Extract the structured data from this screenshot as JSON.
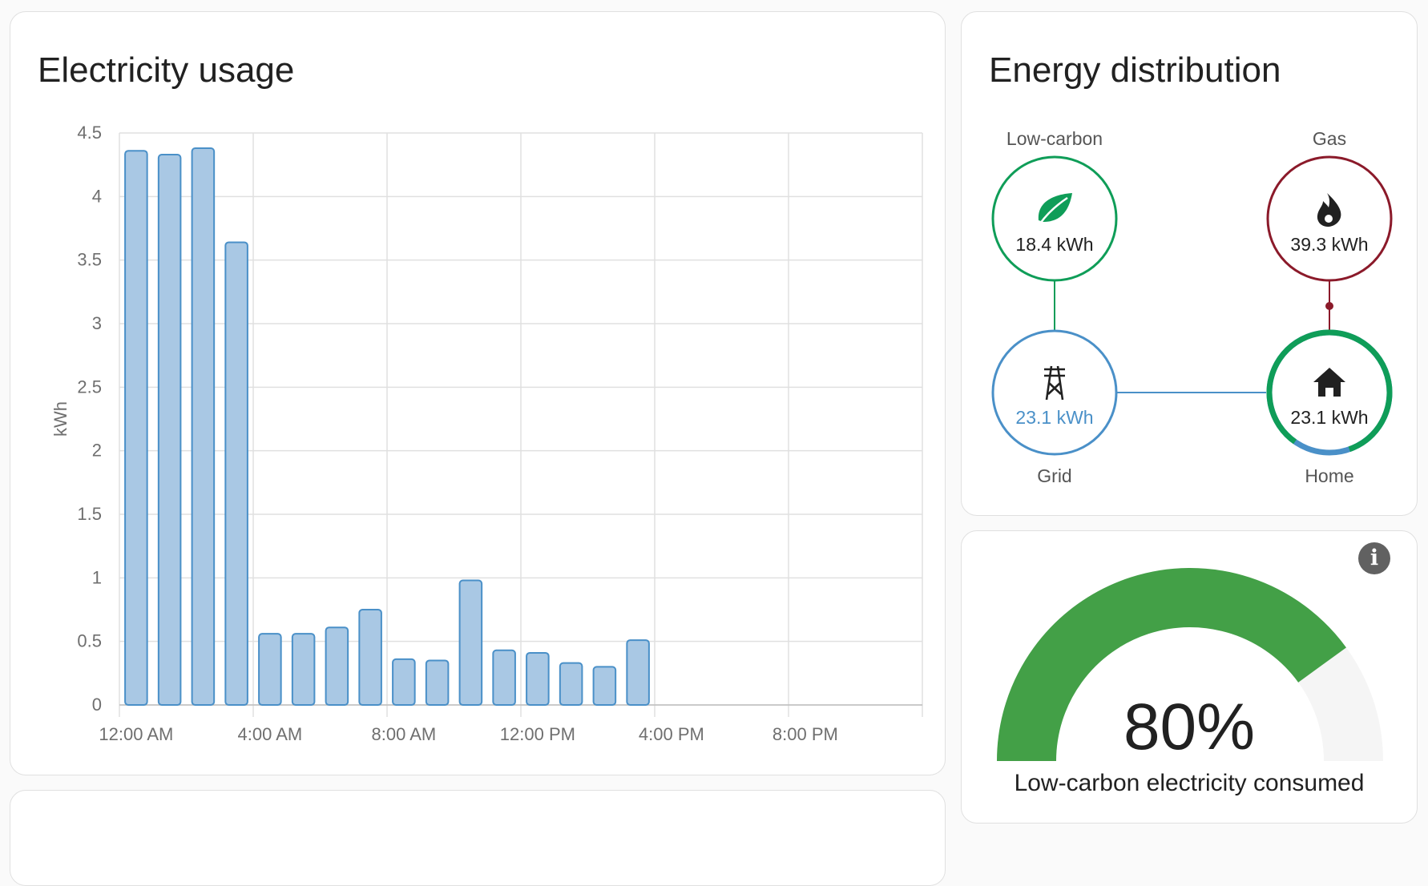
{
  "usage_card": {
    "title": "Electricity usage"
  },
  "chart_data": {
    "type": "bar",
    "title": "Electricity usage",
    "ylabel": "kWh",
    "xlabel": "",
    "ylim": [
      0,
      4.5
    ],
    "y_ticks": [
      "0",
      "0.5",
      "1",
      "1.5",
      "2",
      "2.5",
      "3",
      "3.5",
      "4",
      "4.5"
    ],
    "x_tick_labels": [
      "12:00 AM",
      "4:00 AM",
      "8:00 AM",
      "12:00 PM",
      "4:00 PM",
      "8:00 PM"
    ],
    "categories": [
      "00:00",
      "01:00",
      "02:00",
      "03:00",
      "04:00",
      "05:00",
      "06:00",
      "07:00",
      "08:00",
      "09:00",
      "10:00",
      "11:00",
      "12:00",
      "13:00",
      "14:00",
      "15:00",
      "16:00",
      "17:00",
      "18:00",
      "19:00",
      "20:00",
      "21:00",
      "22:00",
      "23:00"
    ],
    "values": [
      4.36,
      4.33,
      4.38,
      3.64,
      0.56,
      0.56,
      0.61,
      0.75,
      0.36,
      0.35,
      0.98,
      0.43,
      0.41,
      0.33,
      0.3,
      0.51
    ],
    "grid": true,
    "colors": {
      "bar_fill": "#a9c8e4",
      "bar_stroke": "#4a90c8"
    }
  },
  "distribution": {
    "title": "Energy distribution",
    "low_carbon": {
      "label": "Low-carbon",
      "value": "18.4 kWh",
      "color": "#0f9d58",
      "icon": "leaf-icon"
    },
    "gas": {
      "label": "Gas",
      "value": "39.3 kWh",
      "color": "#8b1a2a",
      "icon": "fire-icon"
    },
    "grid": {
      "label": "Grid",
      "value": "23.1 kWh",
      "color": "#4a90c8",
      "icon": "transmission-tower-icon"
    },
    "home": {
      "label": "Home",
      "value": "23.1 kWh",
      "color": "#0f9d58",
      "icon": "home-icon"
    }
  },
  "gauge": {
    "value_text": "80%",
    "value": 0.8,
    "label": "Low-carbon electricity consumed",
    "color": "#43a047",
    "track_color": "#f5f5f5",
    "info_icon": "info-icon",
    "info_text": "i"
  }
}
